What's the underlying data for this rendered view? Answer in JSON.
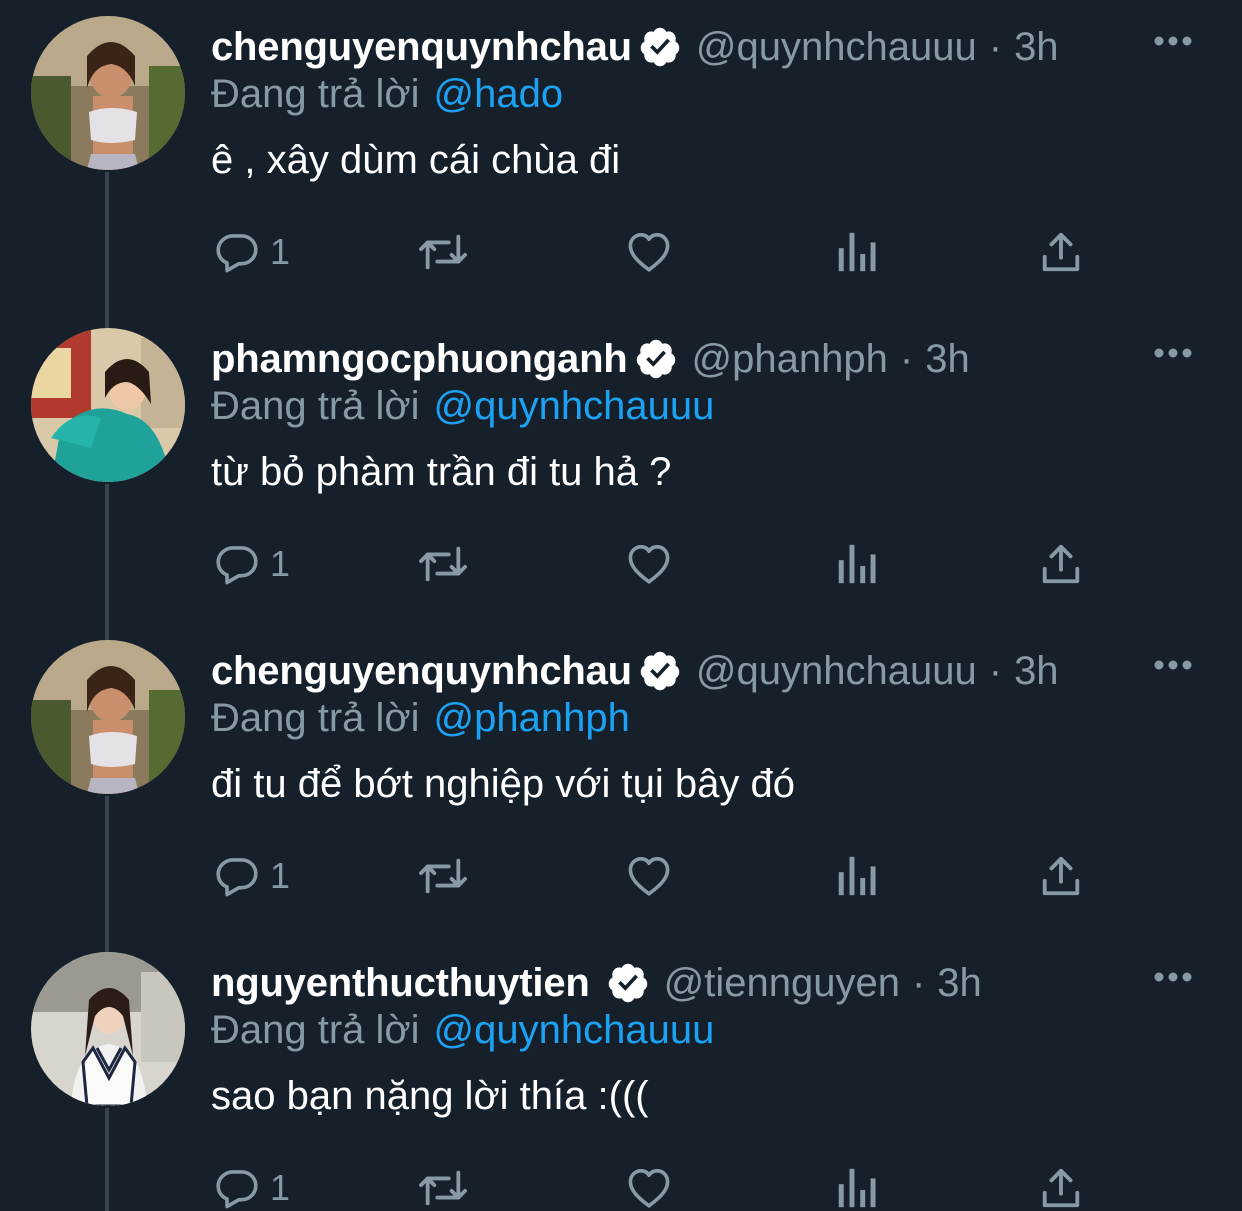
{
  "colors": {
    "background": "#15202b",
    "text_primary": "#ffffff",
    "text_secondary": "#8899a6",
    "link": "#1da1f2",
    "thread_line": "#38444d"
  },
  "tweets": [
    {
      "display_name": "chenguyenquynhchau",
      "handle": "@quynhchauuu",
      "separator": "·",
      "time": "3h",
      "reply_prefix": "Đang trả lời",
      "reply_to": "@hado",
      "text": "ê , xây dùm cái chùa đi",
      "reply_count": "1",
      "icons": [
        "reply-icon",
        "retweet-icon",
        "like-icon",
        "analytics-icon",
        "share-icon"
      ]
    },
    {
      "display_name": "phamngocphuonganh",
      "handle": "@phanhph",
      "separator": "·",
      "time": "3h",
      "reply_prefix": "Đang trả lời",
      "reply_to": "@quynhchauuu",
      "text": "từ bỏ phàm trần đi tu hả ?",
      "reply_count": "1",
      "icons": [
        "reply-icon",
        "retweet-icon",
        "like-icon",
        "analytics-icon",
        "share-icon"
      ]
    },
    {
      "display_name": "chenguyenquynhchau",
      "handle": "@quynhchauuu",
      "separator": "·",
      "time": "3h",
      "reply_prefix": "Đang trả lời",
      "reply_to": "@phanhph",
      "text": "đi tu để bớt nghiệp với tụi bây đó",
      "reply_count": "1",
      "icons": [
        "reply-icon",
        "retweet-icon",
        "like-icon",
        "analytics-icon",
        "share-icon"
      ]
    },
    {
      "display_name": "nguyenthucthuytien",
      "handle": "@tiennguyen",
      "separator": "·",
      "time": "3h",
      "reply_prefix": "Đang trả lời",
      "reply_to": "@quynhchauuu",
      "text": "sao bạn nặng lời thía :(((",
      "reply_count": "1",
      "icons": [
        "reply-icon",
        "retweet-icon",
        "like-icon",
        "analytics-icon",
        "share-icon"
      ]
    }
  ]
}
